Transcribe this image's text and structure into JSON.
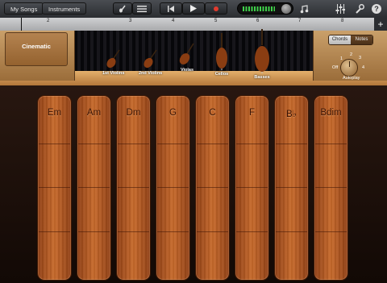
{
  "toolbar": {
    "my_songs": "My Songs",
    "instruments": "Instruments",
    "icons": [
      "violin-icon",
      "track-list-icon",
      "rewind-icon",
      "play-icon",
      "record-icon",
      "master-volume-icon",
      "loop-icon",
      "mixer-icon",
      "settings-icon",
      "help-icon"
    ]
  },
  "ruler": {
    "numbers": [
      "1",
      "2",
      "3",
      "4",
      "5",
      "6",
      "7",
      "8"
    ]
  },
  "stage": {
    "preset": "Cinematic",
    "instruments": [
      "1st Violins",
      "2nd Violins",
      "Violas",
      "Cellos",
      "Basses"
    ]
  },
  "controls": {
    "chords": "Chords",
    "notes": "Notes",
    "autoplay": "Autoplay",
    "off": "Off",
    "d1": "1",
    "d2": "2",
    "d3": "3",
    "d4": "4"
  },
  "chord_strips": [
    "Em",
    "Am",
    "Dm",
    "G",
    "C",
    "F",
    "B♭",
    "Bdim"
  ],
  "colors": {
    "accent_green": "#3fd14a",
    "record_red": "#e23b2e",
    "wood": "#c86b2c"
  }
}
